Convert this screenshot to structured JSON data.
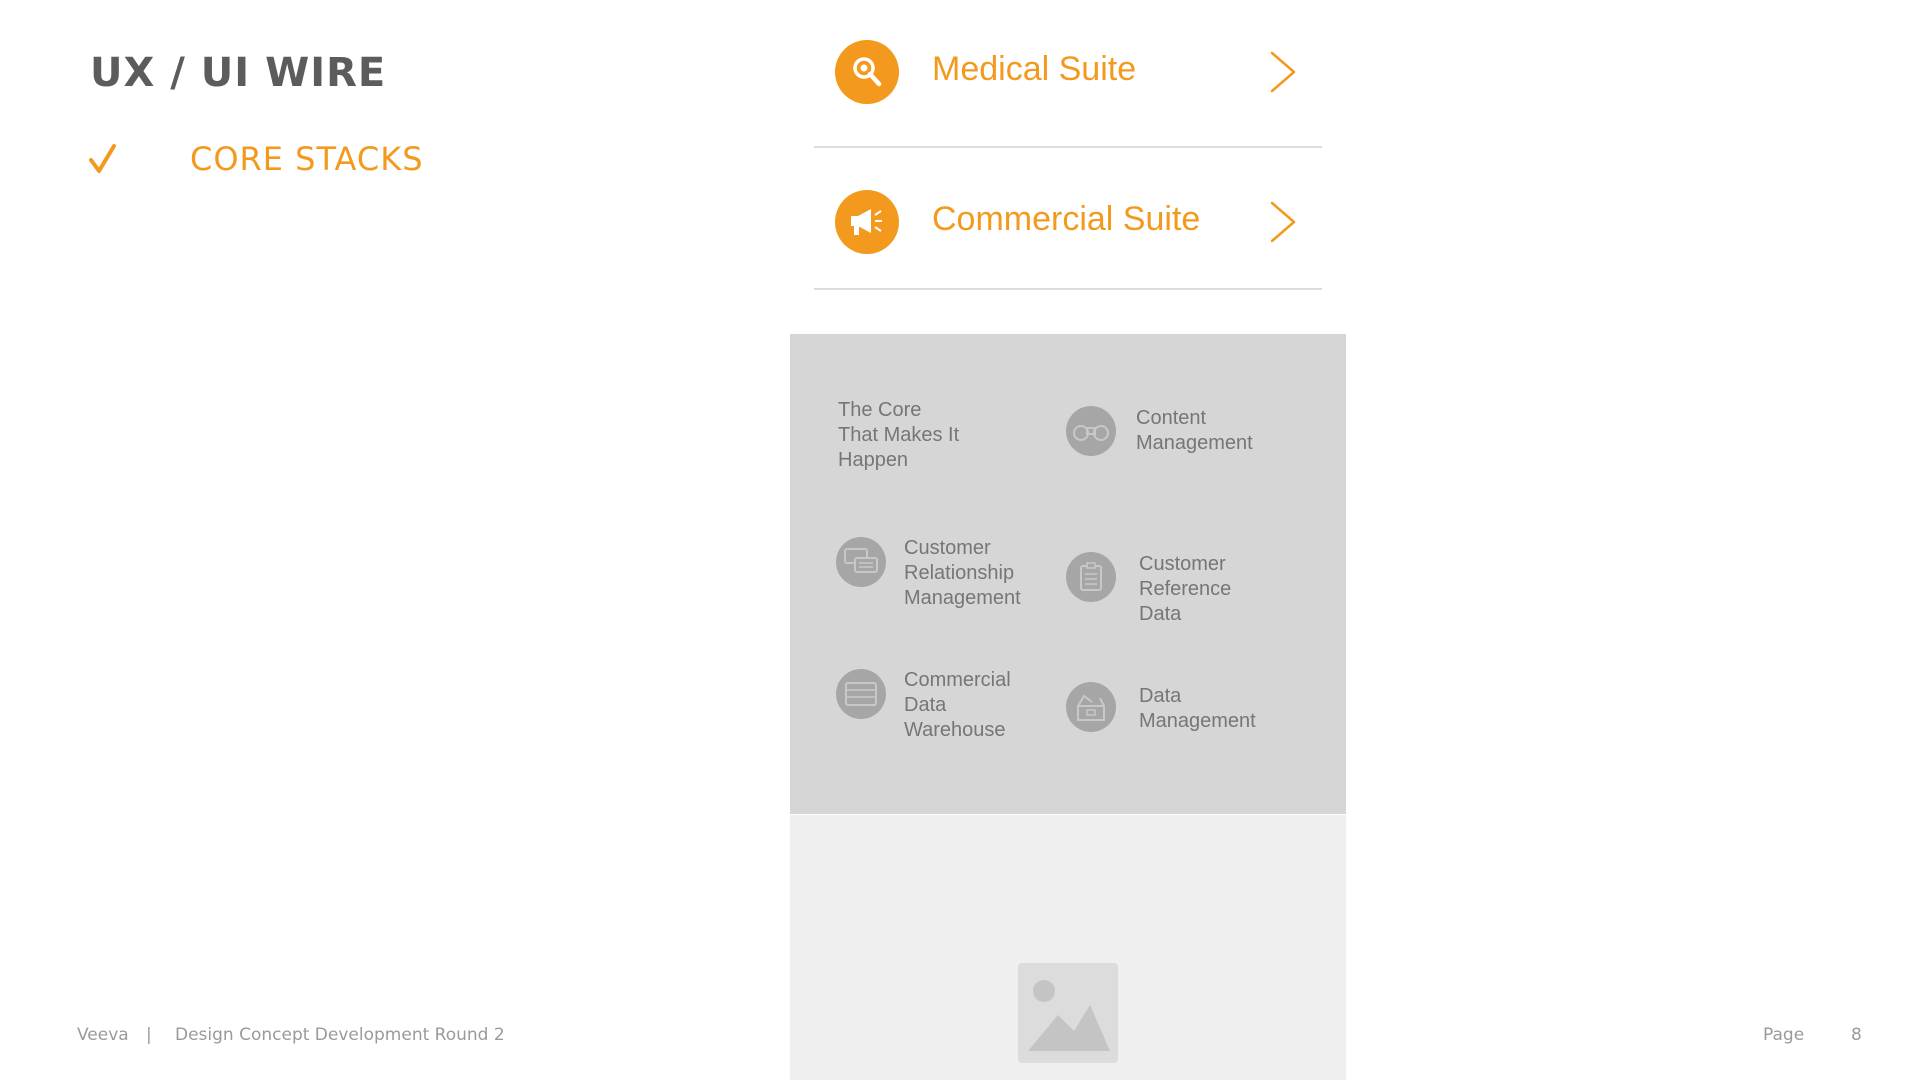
{
  "slide": {
    "title": "UX / UI WIRE",
    "checklist_item": "CORE STACKS",
    "accent_color": "#f39a1e"
  },
  "suites": [
    {
      "label": "Medical Suite",
      "icon": "search-icon"
    },
    {
      "label": "Commercial Suite",
      "icon": "megaphone-icon"
    }
  ],
  "core": {
    "intro": [
      "The Core",
      "That Makes It",
      "Happen"
    ],
    "items": [
      {
        "lines": [
          "Content",
          "Management"
        ],
        "icon": "binoculars-icon"
      },
      {
        "lines": [
          "Customer",
          "Relationship",
          "Management"
        ],
        "icon": "chat-bubbles-icon"
      },
      {
        "lines": [
          "Customer",
          "Reference",
          "Data"
        ],
        "icon": "clipboard-icon"
      },
      {
        "lines": [
          "Commercial",
          "Data",
          "Warehouse"
        ],
        "icon": "server-icon"
      },
      {
        "lines": [
          "Data",
          "Management"
        ],
        "icon": "open-box-icon"
      }
    ]
  },
  "image_panel": {
    "icon": "image-placeholder-icon"
  },
  "footer": {
    "brand": "Veeva",
    "separator": "|",
    "subtitle": "Design Concept Development Round 2",
    "page_label": "Page",
    "page_number": "8"
  }
}
